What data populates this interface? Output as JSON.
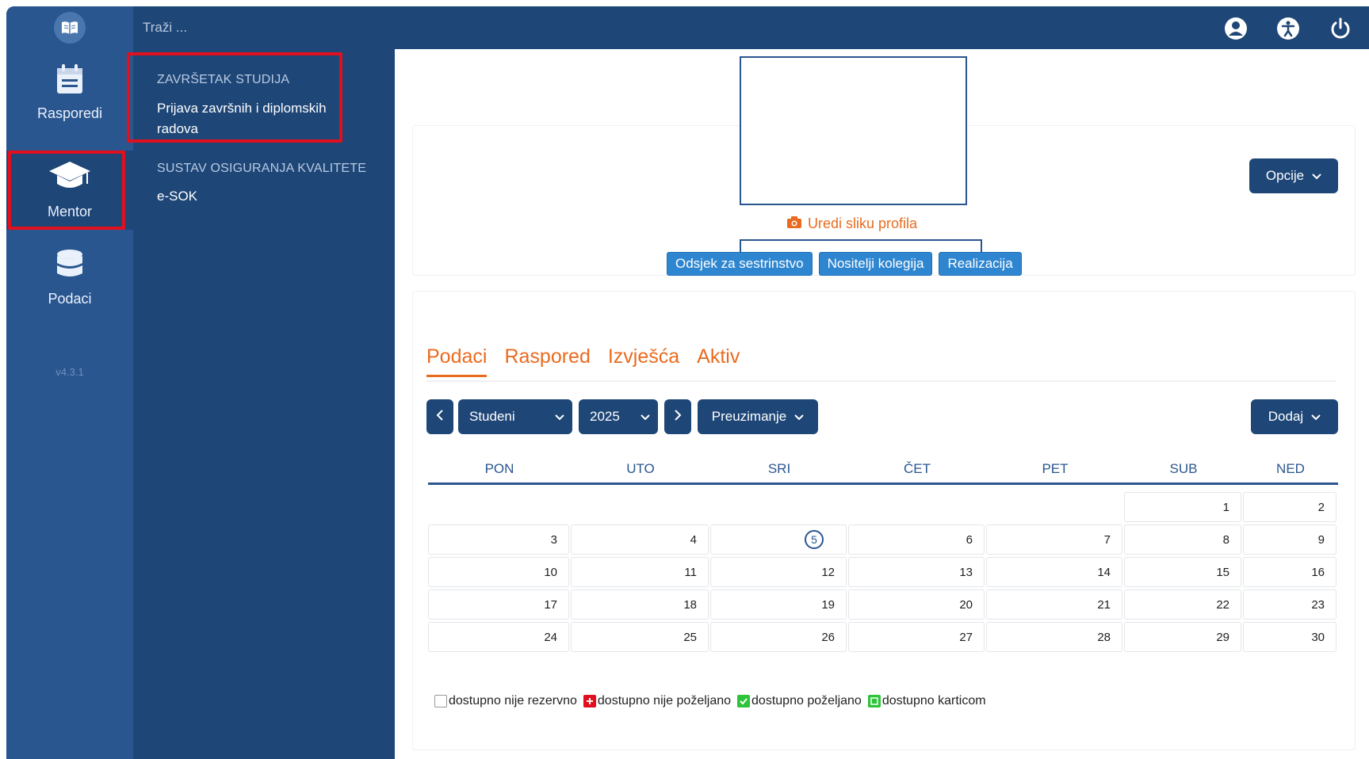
{
  "topbar": {
    "search_placeholder": "Traži ..."
  },
  "rail": {
    "items": [
      {
        "label": "Rasporedi",
        "icon": "calendar-icon"
      },
      {
        "label": "Mentor",
        "icon": "graduation-cap-icon"
      },
      {
        "label": "Podaci",
        "icon": "database-icon"
      }
    ],
    "version": "v4.3.1"
  },
  "submenu": {
    "sections": [
      {
        "title": "ZAVRŠETAK STUDIJA",
        "links": [
          "Prijava završnih i diplomskih",
          "radova"
        ]
      },
      {
        "title": "SUSTAV OSIGURANJA KVALITETE",
        "links": [
          "e-SOK"
        ]
      }
    ]
  },
  "profile": {
    "edit_photo": "Uredi sliku profila",
    "tags": [
      "Odsjek za sestrinstvo",
      "Nositelji kolegija",
      "Realizacija"
    ],
    "options_button": "Opcije"
  },
  "tabs": [
    "Podaci",
    "Raspored",
    "Izvješća",
    "Aktiv"
  ],
  "controls": {
    "month": "Studeni",
    "year": "2025",
    "download": "Preuzimanje",
    "add": "Dodaj"
  },
  "calendar": {
    "weekdays": [
      "PON",
      "UTO",
      "SRI",
      "ČET",
      "PET",
      "SUB",
      "NED"
    ],
    "today": "5",
    "rows": [
      [
        "",
        "",
        "",
        "",
        "",
        "1",
        "2"
      ],
      [
        "3",
        "4",
        "5",
        "6",
        "7",
        "8",
        "9"
      ],
      [
        "10",
        "11",
        "12",
        "13",
        "14",
        "15",
        "16"
      ],
      [
        "17",
        "18",
        "19",
        "20",
        "21",
        "22",
        "23"
      ],
      [
        "24",
        "25",
        "26",
        "27",
        "28",
        "29",
        "30"
      ]
    ]
  },
  "legend": [
    {
      "label": "dostupno nije rezervno",
      "color": "#ffffff"
    },
    {
      "label": "dostupno nije poželjano",
      "color": "#e0101e"
    },
    {
      "label": "dostupno poželjano",
      "color": "#2ec43a"
    },
    {
      "label": "dostupno karticom",
      "color": "#2ec43a"
    }
  ],
  "colors": {
    "navy": "#1e4677",
    "rail": "#2a5690",
    "accent_orange": "#ea6b1f",
    "tag_blue": "#2f86d0",
    "highlight_red": "#e0101e"
  }
}
